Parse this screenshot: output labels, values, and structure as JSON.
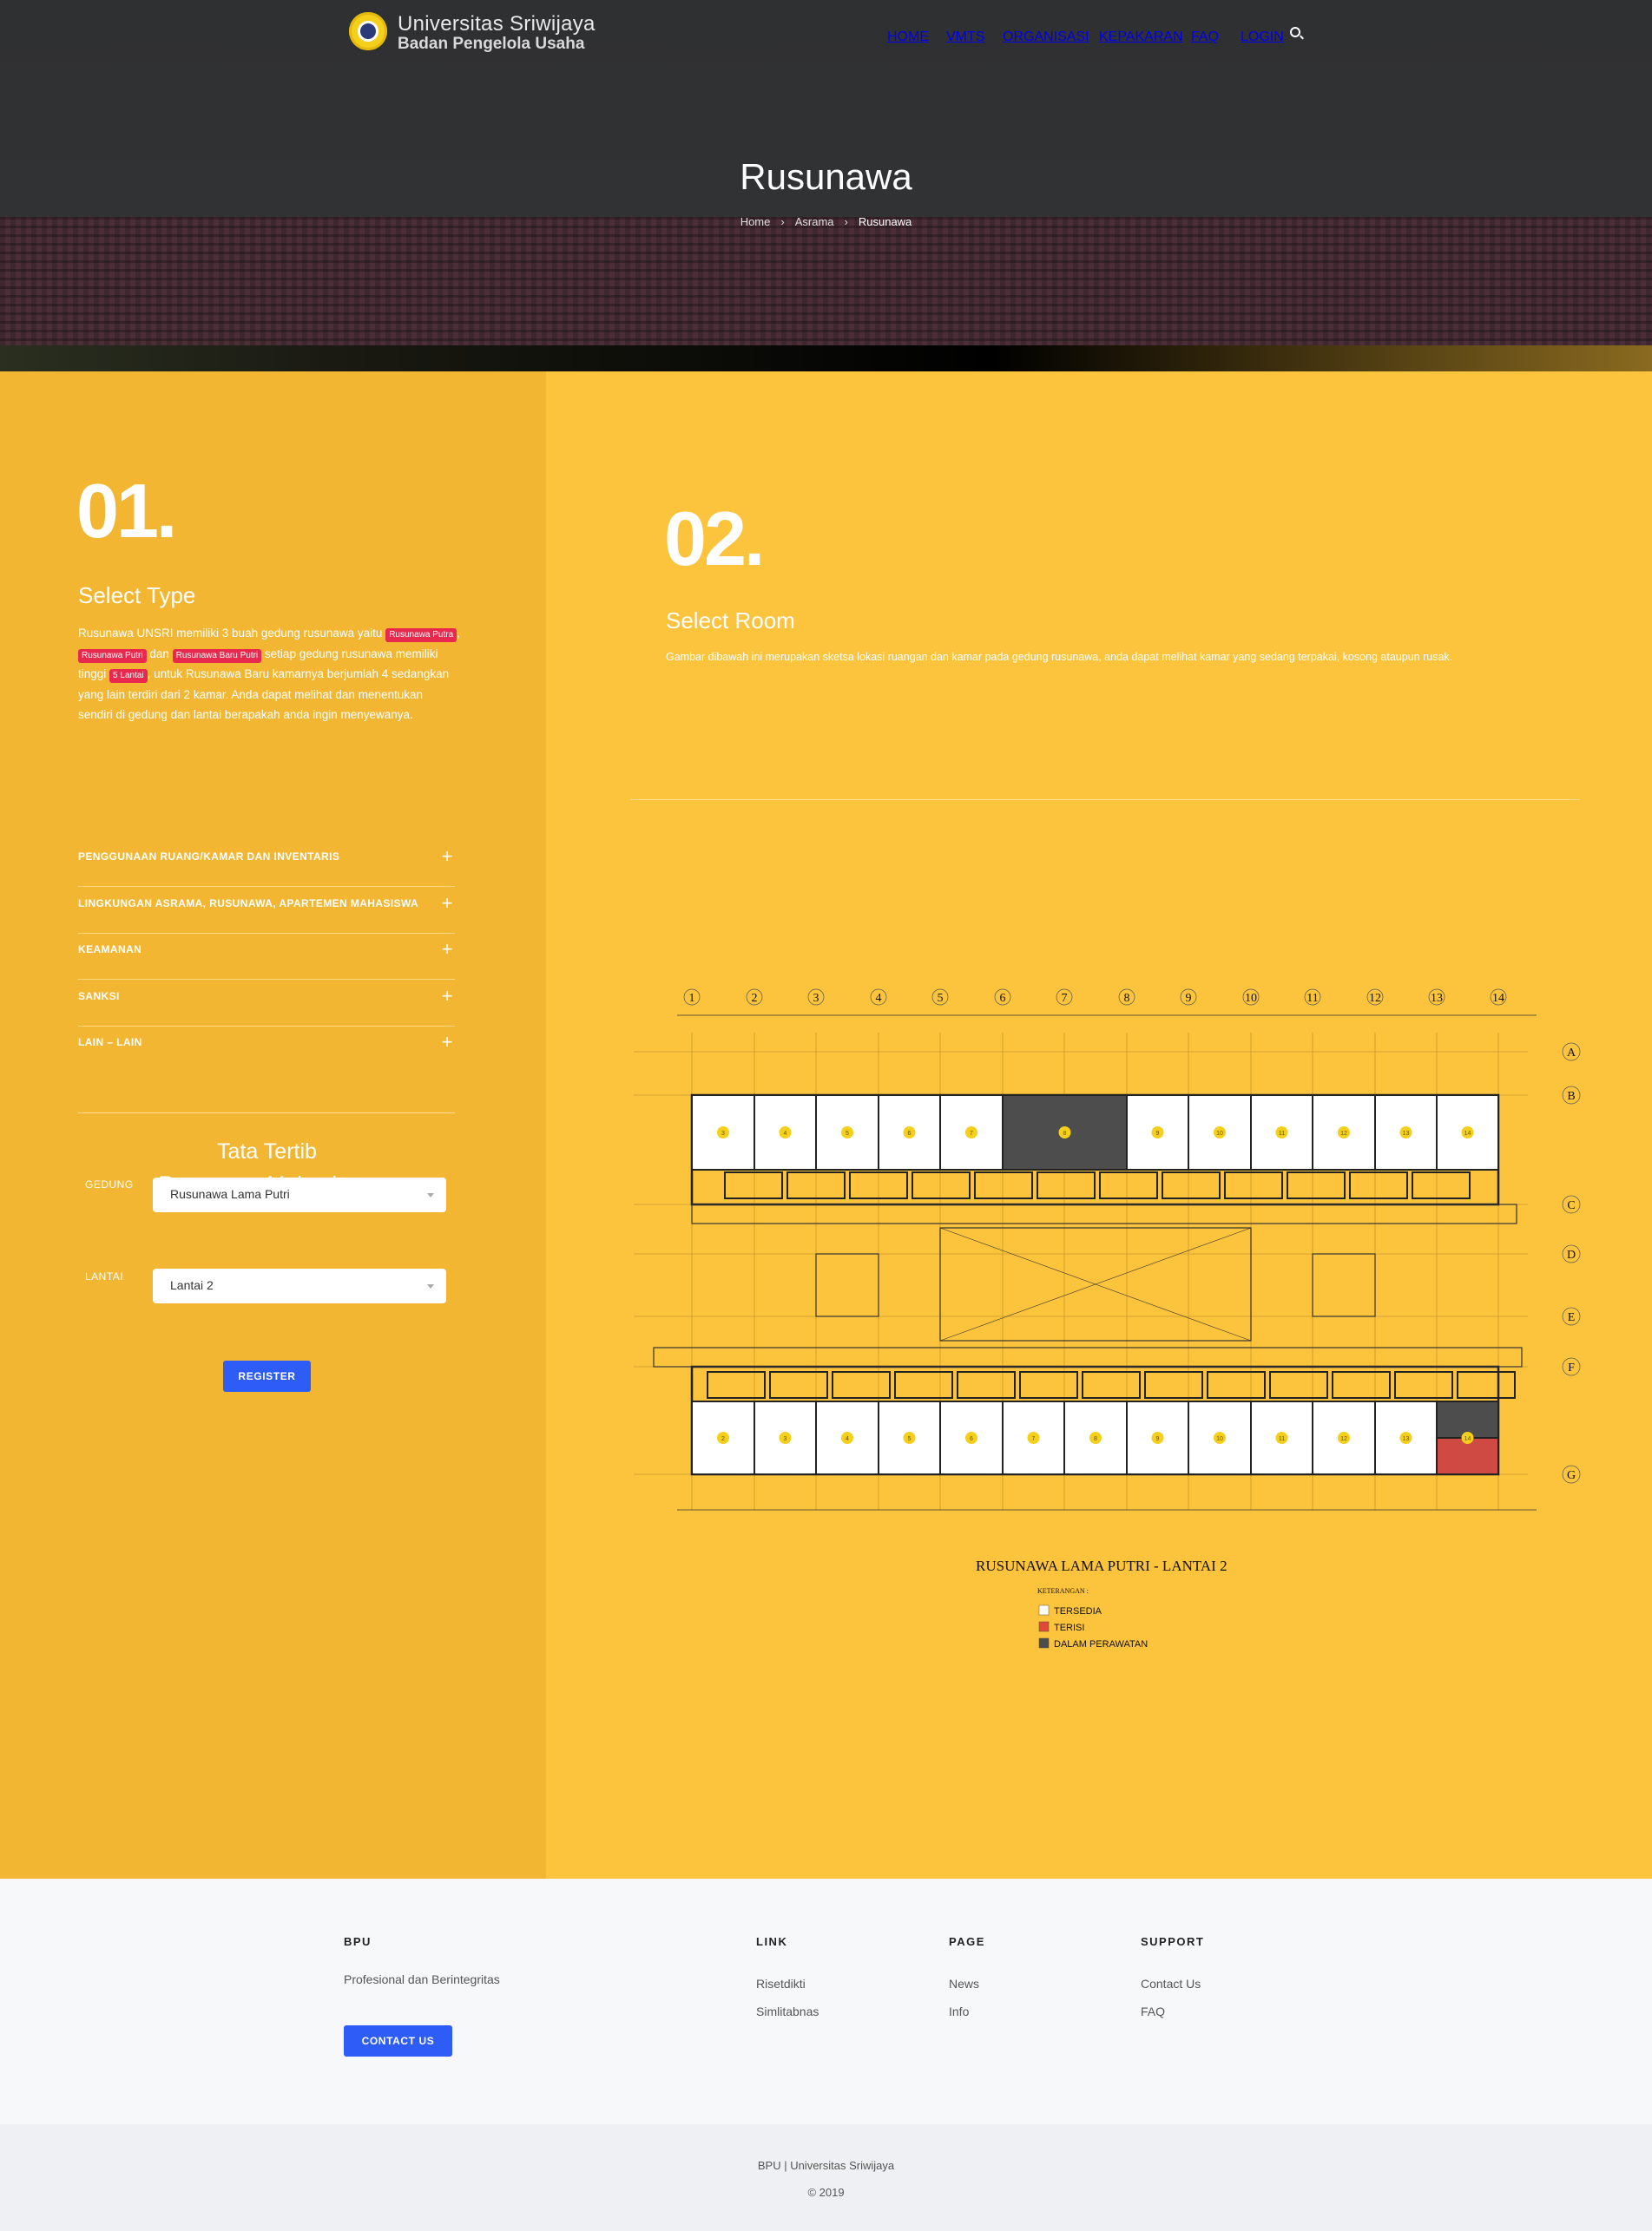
{
  "header": {
    "brand_line1": "Universitas Sriwijaya",
    "brand_line2": "Badan Pengelola Usaha",
    "nav": [
      "HOME",
      "VMTS",
      "ORGANISASI",
      "KEPAKARAN",
      "FAQ",
      "LOGIN"
    ],
    "page_title": "Rusunawa",
    "breadcrumb": [
      "Home",
      "Asrama",
      "Rusunawa"
    ]
  },
  "step1": {
    "number": "01.",
    "title": "Select Type",
    "intro": "Rusunawa UNSRI memiliki 3 buah gedung rusunawa yaitu",
    "tag1": "Rusunawa Putra",
    "tag2": "Rusunawa Putri",
    "and": "dan",
    "tag3": "Rusunawa Baru Putri",
    "mid": "setiap gedung rusunawa memiliki tinggi",
    "tag4": "5 Lantai",
    "rest": ", untuk Rusunawa Baru kamarnya berjumlah 4 sedangkan yang lain terdiri dari 2 kamar. Anda dapat melihat dan menentukan sendiri di gedung dan lantai berapakah anda ingin menyewanya.",
    "rules_title_1": "Tata Tertib",
    "rules_title_2": "Rusunawa Mahasiswa",
    "rules": [
      "PENGGUNAAN RUANG/KAMAR DAN INVENTARIS",
      "LINGKUNGAN ASRAMA, RUSUNAWA, APARTEMEN MAHASISWA",
      "KEAMANAN",
      "SANKSI",
      "LAIN – LAIN"
    ],
    "gedung_label": "GEDUNG",
    "gedung_value": "Rusunawa Lama Putri",
    "lantai_label": "LANTAI",
    "lantai_value": "Lantai 2",
    "register": "REGISTER"
  },
  "step2": {
    "number": "02.",
    "title": "Select Room",
    "desc": "Gambar dibawah ini merupakan sketsa lokasi ruangan dan kamar pada gedung rusunawa, anda dapat melihat kamar yang sedang terpakai, kosong ataupun rusak.",
    "plan_title": "RUSUNAWA LAMA PUTRI   - LANTAI 2",
    "legend_title": "KETERANGAN :",
    "legend": [
      {
        "label": "TERSEDIA",
        "color": "#ffffff"
      },
      {
        "label": "TERISI",
        "color": "#e04a3a"
      },
      {
        "label": "DALAM PERAWATAN",
        "color": "#4d4d4d"
      }
    ],
    "col_labels": [
      "1",
      "2",
      "3",
      "4",
      "5",
      "6",
      "7",
      "8",
      "9",
      "10",
      "11",
      "12",
      "13",
      "14"
    ],
    "row_labels": [
      "A",
      "B",
      "C",
      "D",
      "E",
      "F",
      "G"
    ],
    "top_rooms": [
      "3",
      "4",
      "5",
      "6",
      "7",
      "8",
      "9",
      "10",
      "11",
      "12",
      "13",
      "14"
    ],
    "bottom_rooms": [
      "2",
      "3",
      "4",
      "5",
      "6",
      "7",
      "8",
      "9",
      "10",
      "11",
      "12",
      "13",
      "14"
    ],
    "room_colors": {
      "available": "#ffffff",
      "occupied": "#d04a44",
      "maintenance": "#4d4d4d"
    }
  },
  "footer": {
    "bpu_title": "BPU",
    "bpu_text": "Profesional dan Berintegritas",
    "contact_btn": "CONTACT US",
    "link_title": "LINK",
    "links": [
      "Risetdikti",
      "Simlitabnas"
    ],
    "page_title": "PAGE",
    "pages": [
      "News",
      "Info"
    ],
    "support_title": "SUPPORT",
    "support": [
      "Contact Us",
      "FAQ"
    ],
    "copy1": "BPU | Universitas Sriwijaya",
    "copy2": "© 2019"
  }
}
